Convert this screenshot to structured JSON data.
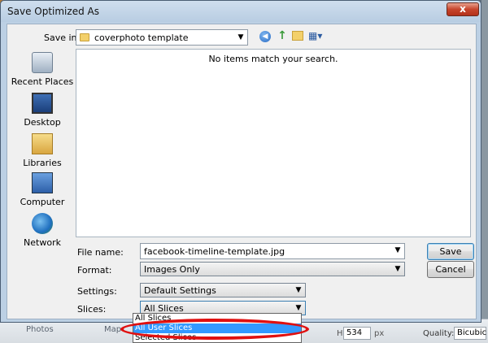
{
  "dialog": {
    "title": "Save Optimized As",
    "close_label": "x"
  },
  "save_in": {
    "label": "Save in:",
    "value": "coverphoto template"
  },
  "places": [
    {
      "label": "Recent Places",
      "icon": "recent-places-icon"
    },
    {
      "label": "Desktop",
      "icon": "desktop-icon"
    },
    {
      "label": "Libraries",
      "icon": "libraries-icon"
    },
    {
      "label": "Computer",
      "icon": "computer-icon"
    },
    {
      "label": "Network",
      "icon": "network-icon"
    }
  ],
  "file_list": {
    "empty_message": "No items match your search."
  },
  "file_name": {
    "label": "File name:",
    "value": "facebook-timeline-template.jpg"
  },
  "format": {
    "label": "Format:",
    "value": "Images Only"
  },
  "settings": {
    "label": "Settings:",
    "value": "Default Settings"
  },
  "slices": {
    "label": "Slices:",
    "value": "All Slices",
    "options": [
      "All Slices",
      "All User Slices",
      "Selected Slices"
    ],
    "highlighted": "All User Slices"
  },
  "buttons": {
    "save": "Save",
    "cancel": "Cancel"
  },
  "background": {
    "photos": "Photos",
    "map": "Map",
    "h_label": "H:",
    "h_value": "534",
    "unit": "px",
    "quality_label": "Quality:",
    "quality_value": "Bicubic"
  },
  "colors": {
    "highlight": "#3399ff",
    "annotation_oval": "#e01010"
  }
}
